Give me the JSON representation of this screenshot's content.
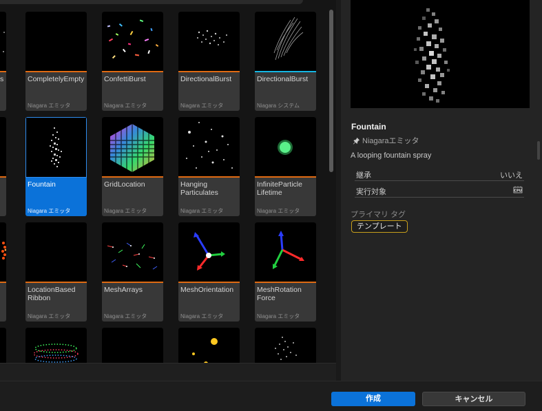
{
  "emitters": [
    {
      "name": "CompletelyEmpty",
      "type": "Niagara エミッタ",
      "selected": false,
      "kind": "emitter"
    },
    {
      "name": "ConfettiBurst",
      "type": "Niagara エミッタ",
      "selected": false,
      "kind": "emitter"
    },
    {
      "name": "DirectionalBurst",
      "type": "Niagara エミッタ",
      "selected": false,
      "kind": "emitter"
    },
    {
      "name": "DirectionalBurst",
      "type": "Niagara システム",
      "selected": false,
      "kind": "system"
    },
    {
      "name": "Fountain",
      "type": "Niagara エミッタ",
      "selected": true,
      "kind": "emitter"
    },
    {
      "name": "GridLocation",
      "type": "Niagara エミッタ",
      "selected": false,
      "kind": "emitter"
    },
    {
      "name": "Hanging Particulates",
      "type": "Niagara エミッタ",
      "selected": false,
      "kind": "emitter"
    },
    {
      "name": "InfiniteParticle Lifetime",
      "type": "Niagara エミッタ",
      "selected": false,
      "kind": "emitter"
    },
    {
      "name": "LocationBased Ribbon",
      "type": "Niagara エミッタ",
      "selected": false,
      "kind": "emitter"
    },
    {
      "name": "MeshArrays",
      "type": "Niagara エミッタ",
      "selected": false,
      "kind": "emitter"
    },
    {
      "name": "MeshOrientation",
      "type": "Niagara エミッタ",
      "selected": false,
      "kind": "emitter"
    },
    {
      "name": "MeshRotation Force",
      "type": "Niagara エミッタ",
      "selected": false,
      "kind": "emitter"
    }
  ],
  "partial_left": {
    "row1_name": "s"
  },
  "details": {
    "title": "Fountain",
    "type": "Niagaraエミッタ",
    "description": "A looping fountain spray",
    "props": [
      {
        "key": "継承",
        "value": "いいえ"
      },
      {
        "key": "実行対象",
        "value": "CPU"
      }
    ],
    "tags_label": "プライマリ タグ",
    "tag": "テンプレート"
  },
  "footer": {
    "create_label": "作成",
    "cancel_label": "キャンセル"
  },
  "colors": {
    "accent_emitter": "#e06a12",
    "accent_system": "#14b6e3",
    "selected": "#0b72d9",
    "tag_border": "#c9a01b"
  }
}
